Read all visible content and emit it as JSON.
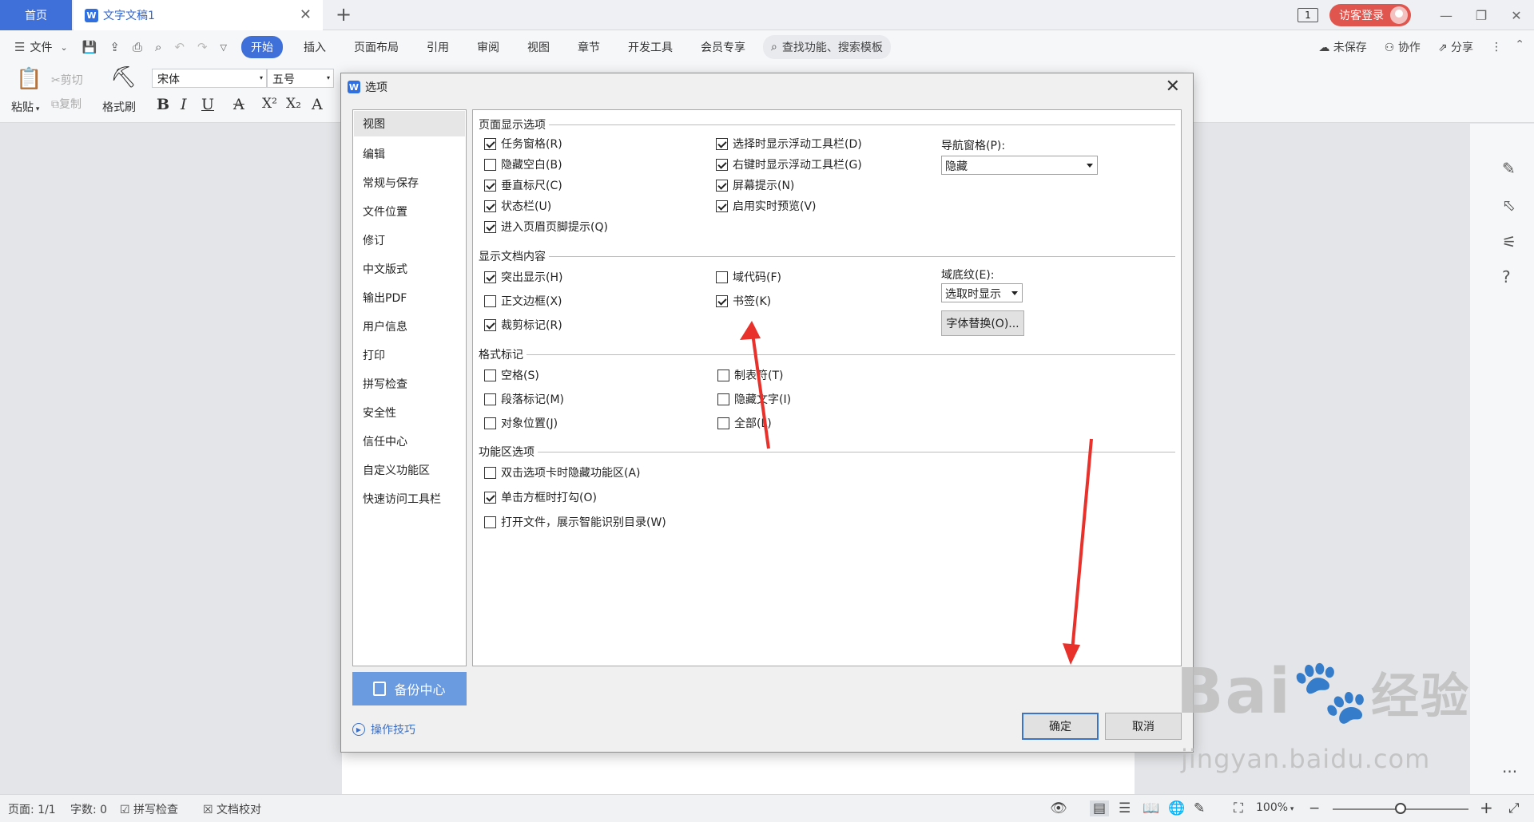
{
  "tabs": {
    "home": "首页",
    "document": "文字文稿1"
  },
  "titlebar": {
    "page_indicator": "1",
    "login_label": "访客登录"
  },
  "menubar": {
    "file": "文件",
    "items": [
      "开始",
      "插入",
      "页面布局",
      "引用",
      "审阅",
      "视图",
      "章节",
      "开发工具",
      "会员专享"
    ],
    "search_placeholder": "查找功能、搜索模板",
    "unsaved": "未保存",
    "collaborate": "协作",
    "share": "分享"
  },
  "ribbon": {
    "paste": "粘贴",
    "cut": "剪切",
    "copy": "复制",
    "format_painter": "格式刷",
    "font_name": "宋体",
    "font_size": "五号"
  },
  "dialog": {
    "title": "选项",
    "nav": [
      "视图",
      "编辑",
      "常规与保存",
      "文件位置",
      "修订",
      "中文版式",
      "输出PDF",
      "用户信息",
      "打印",
      "拼写检查",
      "安全性",
      "信任中心",
      "自定义功能区",
      "快速访问工具栏"
    ],
    "selected_nav": "视图",
    "backup_center": "备份中心",
    "tips": "操作技巧",
    "sections": {
      "page_display": {
        "title": "页面显示选项",
        "col1": [
          {
            "label": "任务窗格(R)",
            "checked": true
          },
          {
            "label": "隐藏空白(B)",
            "checked": false
          },
          {
            "label": "垂直标尺(C)",
            "checked": true
          },
          {
            "label": "状态栏(U)",
            "checked": true
          },
          {
            "label": "进入页眉页脚提示(Q)",
            "checked": true
          }
        ],
        "col2": [
          {
            "label": "选择时显示浮动工具栏(D)",
            "checked": true
          },
          {
            "label": "右键时显示浮动工具栏(G)",
            "checked": true
          },
          {
            "label": "屏幕提示(N)",
            "checked": true
          },
          {
            "label": "启用实时预览(V)",
            "checked": true
          }
        ],
        "nav_pane_label": "导航窗格(P):",
        "nav_pane_value": "隐藏"
      },
      "doc_content": {
        "title": "显示文档内容",
        "col1": [
          {
            "label": "突出显示(H)",
            "checked": true
          },
          {
            "label": "正文边框(X)",
            "checked": false
          },
          {
            "label": "裁剪标记(R)",
            "checked": true
          }
        ],
        "col2": [
          {
            "label": "域代码(F)",
            "checked": false
          },
          {
            "label": "书签(K)",
            "checked": true
          }
        ],
        "field_shading_label": "域底纹(E):",
        "field_shading_value": "选取时显示",
        "font_substitution": "字体替换(O)..."
      },
      "format_marks": {
        "title": "格式标记",
        "col1": [
          {
            "label": "空格(S)",
            "checked": false
          },
          {
            "label": "段落标记(M)",
            "checked": false
          },
          {
            "label": "对象位置(J)",
            "checked": false
          }
        ],
        "col2": [
          {
            "label": "制表符(T)",
            "checked": false
          },
          {
            "label": "隐藏文字(I)",
            "checked": false
          },
          {
            "label": "全部(L)",
            "checked": false
          }
        ]
      },
      "ribbon_options": {
        "title": "功能区选项",
        "items": [
          {
            "label": "双击选项卡时隐藏功能区(A)",
            "checked": false
          },
          {
            "label": "单击方框时打勾(O)",
            "checked": true
          },
          {
            "label": "打开文件，展示智能识别目录(W)",
            "checked": false
          }
        ]
      }
    },
    "ok": "确定",
    "cancel": "取消"
  },
  "statusbar": {
    "page": "页面: 1/1",
    "words": "字数: 0",
    "spell_check": "拼写检查",
    "doc_proof": "文档校对",
    "zoom": "100%"
  },
  "annotation": {
    "arrow_color": "#e8312a"
  },
  "watermark": {
    "brand": "Bai",
    "brand_cn": "经验",
    "url": "jingyan.baidu.com"
  },
  "colors": {
    "accent": "#3f6fd8",
    "login": "#e0554e",
    "backup": "#6a9be0"
  }
}
